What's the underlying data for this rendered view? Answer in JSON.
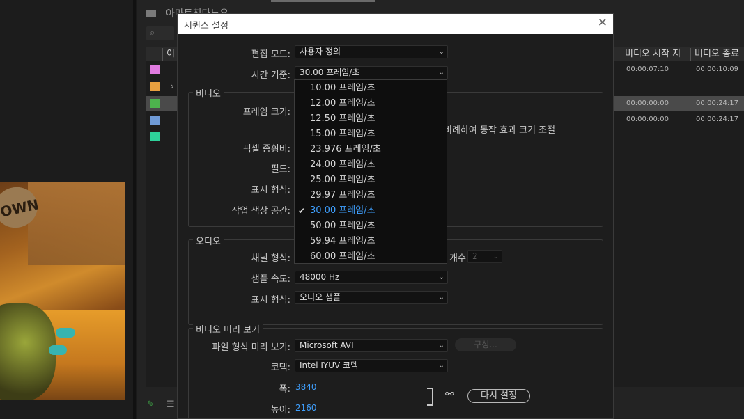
{
  "background": {
    "project_title": "아마트칭다ᄂᄋ",
    "video_banner_text": "OWN",
    "columns": [
      "이",
      "비디오 시작 지",
      "비디오 종료"
    ],
    "rows": [
      {
        "label_color": "#e07be0",
        "video_start": "00:00:07:10",
        "video_end": "00:00:10:09"
      },
      {
        "label_color": "#e8a040",
        "video_start": "",
        "video_end": ""
      },
      {
        "label_color": "#4db34d",
        "video_start": "00:00:00:00",
        "video_end": "00:00:24:17"
      },
      {
        "label_color": "#6f9ad6",
        "video_start": "00:00:00:00",
        "video_end": "00:00:24:17"
      },
      {
        "label_color": "#2ed19a",
        "video_start": "",
        "video_end": ""
      }
    ]
  },
  "dialog": {
    "title": "시퀀스 설정",
    "editing_mode": {
      "label": "편집 모드:",
      "value": "사용자 정의"
    },
    "timebase": {
      "label": "시간 기준:",
      "value": "30.00  프레임/초"
    },
    "video_group": {
      "title": "비디오",
      "frame_size_label": "프레임 크기:",
      "scale_text": "비례하여 동작 효과 크기 조절",
      "pixel_aspect_label": "픽셀 종횡비:",
      "fields_label": "필드:",
      "display_format_label": "표시 형식:",
      "working_color_label": "작업 색상 공간:"
    },
    "audio_group": {
      "title": "오디오",
      "channel_format_label": "채널 형식:",
      "channels_label": "개수:",
      "channels_value": "2",
      "sample_rate_label": "샘플 속도:",
      "sample_rate_value": "48000 Hz",
      "display_format_label": "표시 형식:",
      "display_format_value": "오디오 샘플"
    },
    "preview_group": {
      "title": "비디오 미리 보기",
      "file_format_label": "파일 형식 미리 보기:",
      "file_format_value": "Microsoft AVI",
      "configure_label": "구성...",
      "codec_label": "코덱:",
      "codec_value": "Intel IYUV 코덱",
      "width_label": "폭:",
      "width_value": "3840",
      "height_label": "높이:",
      "height_value": "2160",
      "reset_label": "다시 설정"
    },
    "timebase_options": [
      "10.00  프레임/초",
      "12.00  프레임/초",
      "12.50  프레임/초",
      "15.00  프레임/초",
      "23.976  프레임/초",
      "24.00  프레임/초",
      "25.00  프레임/초",
      "29.97  프레임/초",
      "30.00  프레임/초",
      "50.00  프레임/초",
      "59.94  프레임/초",
      "60.00  프레임/초"
    ],
    "timebase_selected_index": 8
  }
}
